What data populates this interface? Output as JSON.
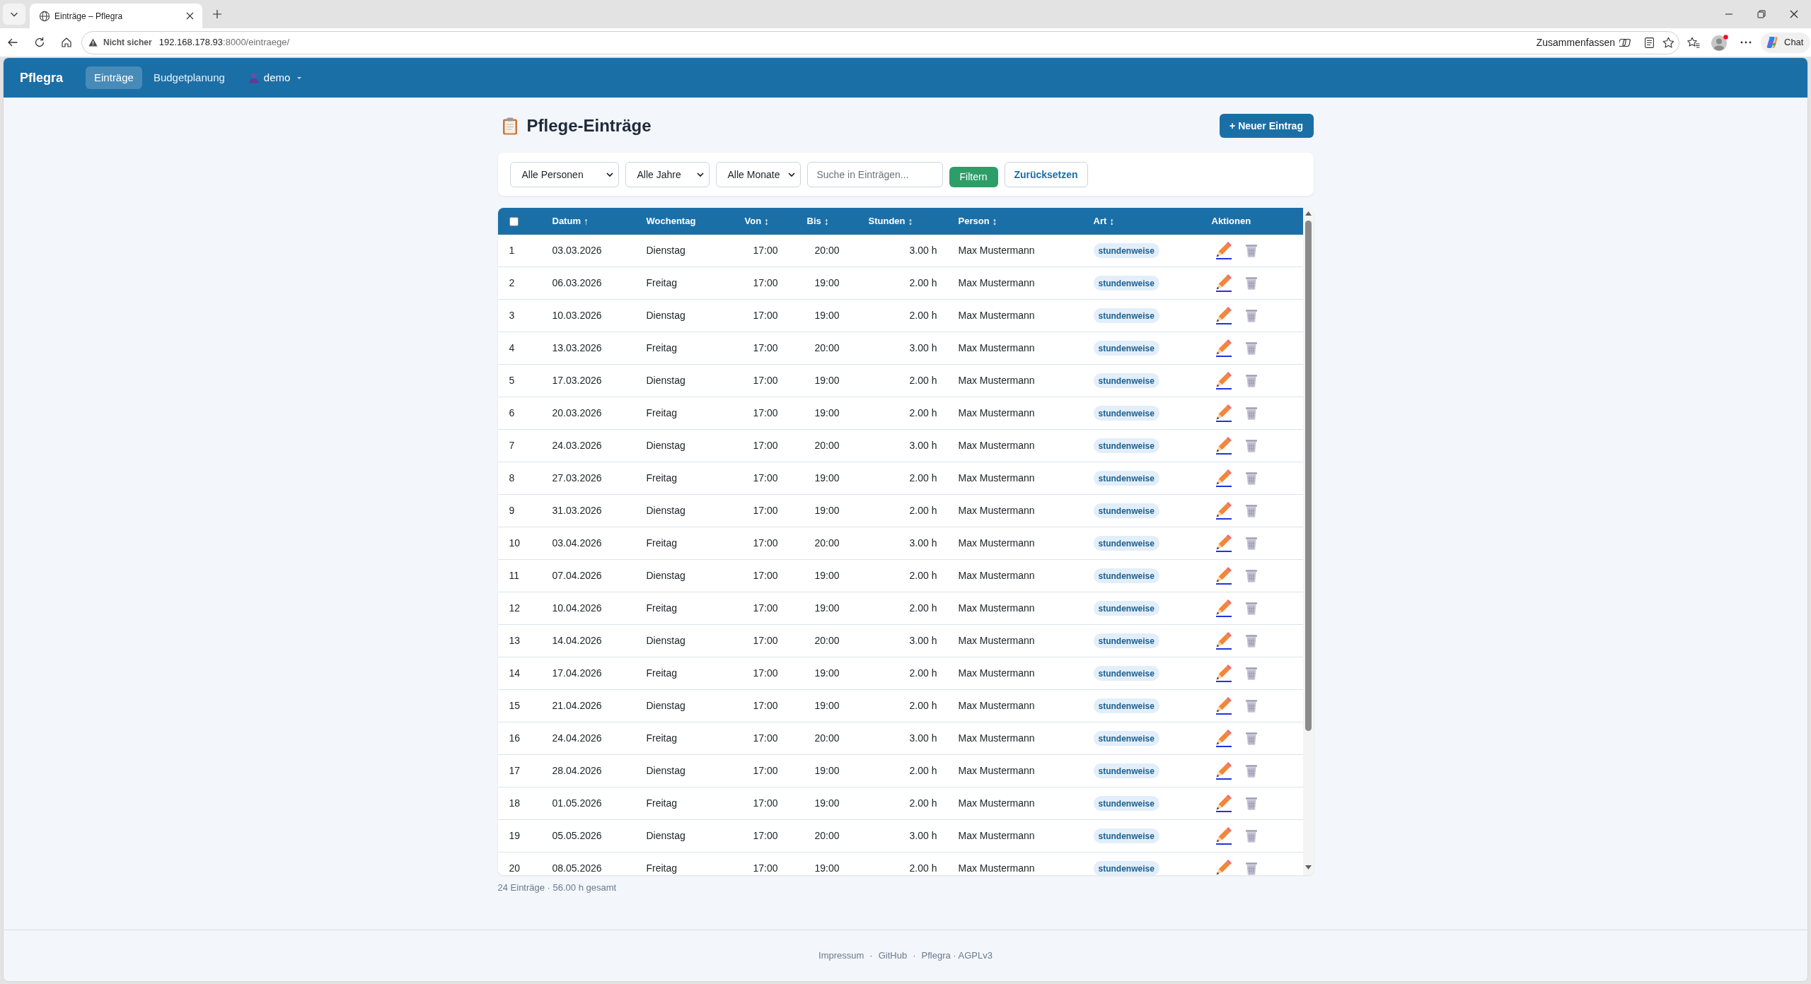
{
  "browser": {
    "tab": {
      "title": "Einträge – Pflegra"
    },
    "address_bar": {
      "security_label": "Nicht sicher",
      "host": "192.168.178.93",
      "path": ":8000/eintraege/"
    },
    "summarize_button": "Zusammenfassen",
    "chat_button": "Chat"
  },
  "navbar": {
    "brand": "Pflegra",
    "items": [
      {
        "label": "Einträge",
        "selected": true
      },
      {
        "label": "Budgetplanung",
        "selected": false
      }
    ],
    "user": "demo"
  },
  "page": {
    "title": "Pflege-Einträge",
    "new_button": "+ Neuer Eintrag"
  },
  "filters": {
    "selects": [
      "Alle Personen",
      "Alle Jahre",
      "Alle Monate"
    ],
    "search": {
      "placeholder": "Suche in Einträgen..."
    },
    "buttons": [
      {
        "kind": "primary",
        "label": "Filtern"
      },
      {
        "kind": "secondary",
        "label": "Zurücksetzen"
      }
    ]
  },
  "table": {
    "select_all": {
      "checked": false
    },
    "columns": [
      {
        "label": "Datum",
        "sort": "↑"
      },
      {
        "label": "Wochentag"
      },
      {
        "label": "Von",
        "sort": "↕"
      },
      {
        "label": "Bis",
        "sort": "↕"
      },
      {
        "label": "Stunden",
        "sort": "↕"
      },
      {
        "label": "Person",
        "sort": "↕"
      },
      {
        "label": "Art",
        "sort": "↕"
      },
      {
        "label": "Aktionen"
      }
    ],
    "rows": [
      {
        "number": "1",
        "date": "03.03.2026",
        "weekday": "Dienstag",
        "from": "17:00",
        "to": "20:00",
        "hours": "3.00 h",
        "person": "Max Mustermann",
        "type": "stundenweise"
      },
      {
        "number": "2",
        "date": "06.03.2026",
        "weekday": "Freitag",
        "from": "17:00",
        "to": "19:00",
        "hours": "2.00 h",
        "person": "Max Mustermann",
        "type": "stundenweise"
      },
      {
        "number": "3",
        "date": "10.03.2026",
        "weekday": "Dienstag",
        "from": "17:00",
        "to": "19:00",
        "hours": "2.00 h",
        "person": "Max Mustermann",
        "type": "stundenweise"
      },
      {
        "number": "4",
        "date": "13.03.2026",
        "weekday": "Freitag",
        "from": "17:00",
        "to": "20:00",
        "hours": "3.00 h",
        "person": "Max Mustermann",
        "type": "stundenweise"
      },
      {
        "number": "5",
        "date": "17.03.2026",
        "weekday": "Dienstag",
        "from": "17:00",
        "to": "19:00",
        "hours": "2.00 h",
        "person": "Max Mustermann",
        "type": "stundenweise"
      },
      {
        "number": "6",
        "date": "20.03.2026",
        "weekday": "Freitag",
        "from": "17:00",
        "to": "19:00",
        "hours": "2.00 h",
        "person": "Max Mustermann",
        "type": "stundenweise"
      },
      {
        "number": "7",
        "date": "24.03.2026",
        "weekday": "Dienstag",
        "from": "17:00",
        "to": "20:00",
        "hours": "3.00 h",
        "person": "Max Mustermann",
        "type": "stundenweise"
      },
      {
        "number": "8",
        "date": "27.03.2026",
        "weekday": "Freitag",
        "from": "17:00",
        "to": "19:00",
        "hours": "2.00 h",
        "person": "Max Mustermann",
        "type": "stundenweise"
      },
      {
        "number": "9",
        "date": "31.03.2026",
        "weekday": "Dienstag",
        "from": "17:00",
        "to": "19:00",
        "hours": "2.00 h",
        "person": "Max Mustermann",
        "type": "stundenweise"
      },
      {
        "number": "10",
        "date": "03.04.2026",
        "weekday": "Freitag",
        "from": "17:00",
        "to": "20:00",
        "hours": "3.00 h",
        "person": "Max Mustermann",
        "type": "stundenweise"
      },
      {
        "number": "11",
        "date": "07.04.2026",
        "weekday": "Dienstag",
        "from": "17:00",
        "to": "19:00",
        "hours": "2.00 h",
        "person": "Max Mustermann",
        "type": "stundenweise"
      },
      {
        "number": "12",
        "date": "10.04.2026",
        "weekday": "Freitag",
        "from": "17:00",
        "to": "19:00",
        "hours": "2.00 h",
        "person": "Max Mustermann",
        "type": "stundenweise"
      },
      {
        "number": "13",
        "date": "14.04.2026",
        "weekday": "Dienstag",
        "from": "17:00",
        "to": "20:00",
        "hours": "3.00 h",
        "person": "Max Mustermann",
        "type": "stundenweise"
      },
      {
        "number": "14",
        "date": "17.04.2026",
        "weekday": "Freitag",
        "from": "17:00",
        "to": "19:00",
        "hours": "2.00 h",
        "person": "Max Mustermann",
        "type": "stundenweise"
      },
      {
        "number": "15",
        "date": "21.04.2026",
        "weekday": "Dienstag",
        "from": "17:00",
        "to": "19:00",
        "hours": "2.00 h",
        "person": "Max Mustermann",
        "type": "stundenweise"
      },
      {
        "number": "16",
        "date": "24.04.2026",
        "weekday": "Freitag",
        "from": "17:00",
        "to": "20:00",
        "hours": "3.00 h",
        "person": "Max Mustermann",
        "type": "stundenweise"
      },
      {
        "number": "17",
        "date": "28.04.2026",
        "weekday": "Dienstag",
        "from": "17:00",
        "to": "19:00",
        "hours": "2.00 h",
        "person": "Max Mustermann",
        "type": "stundenweise"
      },
      {
        "number": "18",
        "date": "01.05.2026",
        "weekday": "Freitag",
        "from": "17:00",
        "to": "19:00",
        "hours": "2.00 h",
        "person": "Max Mustermann",
        "type": "stundenweise"
      },
      {
        "number": "19",
        "date": "05.05.2026",
        "weekday": "Dienstag",
        "from": "17:00",
        "to": "20:00",
        "hours": "3.00 h",
        "person": "Max Mustermann",
        "type": "stundenweise"
      },
      {
        "number": "20",
        "date": "08.05.2026",
        "weekday": "Freitag",
        "from": "17:00",
        "to": "19:00",
        "hours": "2.00 h",
        "person": "Max Mustermann",
        "type": "stundenweise"
      }
    ]
  },
  "summary": "24 Einträge · 56.00 h gesamt",
  "footer": {
    "links": [
      "Impressum",
      "GitHub"
    ],
    "separators": [
      "·",
      "·"
    ],
    "text": "Pflegra · AGPLv3"
  }
}
